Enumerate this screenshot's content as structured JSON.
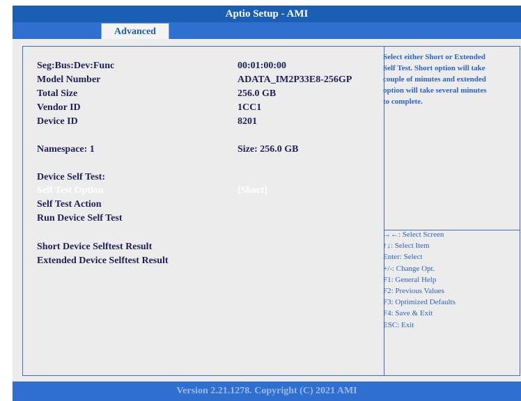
{
  "window": {
    "title": "Aptio Setup - AMI"
  },
  "tabs": [
    {
      "label": "Advanced",
      "active": true
    }
  ],
  "info": [
    {
      "label": "Seg:Bus:Dev:Func",
      "value": "00:01:00:00"
    },
    {
      "label": "Model Number",
      "value": "ADATA_IM2P33E8-256GP"
    },
    {
      "label": "Total Size",
      "value": "256.0 GB"
    },
    {
      "label": "Vendor ID",
      "value": "1CC1"
    },
    {
      "label": "Device ID",
      "value": "8201"
    }
  ],
  "namespace": {
    "label": "Namespace: 1",
    "size": "Size: 256.0 GB"
  },
  "self_test": {
    "heading": "Device Self Test:",
    "option_label": "Self Test Option",
    "option_value": "[Short]",
    "action_label": "Self Test Action",
    "run_label": "Run Device Self Test"
  },
  "results": {
    "short": "Short Device Selftest Result",
    "extended": "Extended Device Selftest Result"
  },
  "help_text": "Select either Short or Extended Self Test. Short option will take couple of minutes and extended option will take several minutes to complete.",
  "key_help": [
    "→←: Select Screen",
    "↑↓: Select Item",
    "Enter: Select",
    "+/-: Change Opt.",
    "F1: General Help",
    "F2: Previous Values",
    "F3: Optimized Defaults",
    "F4: Save & Exit",
    "ESC: Exit"
  ],
  "footer": {
    "text": "Version 2.21.1278. Copyright (C) 2021 AMI"
  },
  "colors": {
    "title_bar": "#1a5fb4",
    "tab_bar": "#2f6fd0",
    "panel_bg": "#ececec",
    "border": "#3d6fc0",
    "text": "#1e1e5a",
    "highlight_text": "#ffffff",
    "help_text": "#2a62c8"
  }
}
